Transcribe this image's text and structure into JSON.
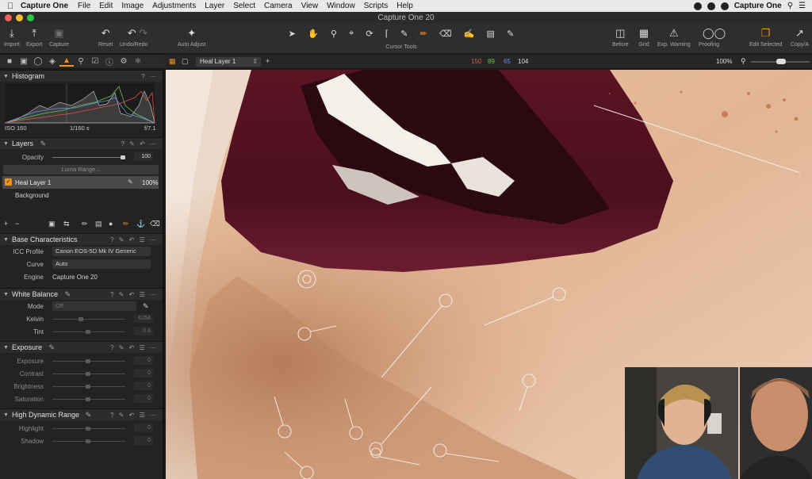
{
  "menubar": {
    "app_name": "Capture One",
    "items": [
      "File",
      "Edit",
      "Image",
      "Adjustments",
      "Layer",
      "Select",
      "Camera",
      "View",
      "Window",
      "Scripts",
      "Help"
    ],
    "right_label": "Capture One"
  },
  "window": {
    "title": "Capture One 20"
  },
  "toolbar": {
    "import": "Import",
    "export": "Export",
    "capture": "Capture",
    "reset": "Reset",
    "undo_redo": "Undo/Redo",
    "auto_adjust": "Auto Adjust",
    "cursor_tools": "Cursor Tools",
    "before": "Before",
    "grid": "Grid",
    "exp_warning": "Exp. Warning",
    "proofing": "Proofing",
    "edit_selected": "Edit Selected",
    "copy_apply": "Copy/A"
  },
  "viewer_bar": {
    "layer": "Heal Layer 1",
    "r": "150",
    "g": "89",
    "b": "65",
    "l": "104",
    "zoom": "100%"
  },
  "histogram": {
    "title": "Histogram",
    "iso": "ISO 160",
    "shutter": "1/160 s",
    "aperture": "f/7.1"
  },
  "layers": {
    "title": "Layers",
    "opacity_label": "Opacity",
    "opacity_value": "100",
    "opacity_level": 1.0,
    "luma_range": "Luma Range...",
    "items": [
      {
        "name": "Heal Layer 1",
        "value": "100%"
      },
      {
        "name": "Background"
      }
    ]
  },
  "base_characteristics": {
    "title": "Base Characteristics",
    "icc_label": "ICC Profile",
    "icc_value": "Canon EOS-5D Mk IV Generic",
    "curve_label": "Curve",
    "curve_value": "Auto",
    "engine_label": "Engine",
    "engine_value": "Capture One 20"
  },
  "white_balance": {
    "title": "White Balance",
    "mode_label": "Mode",
    "mode_value": "Off",
    "kelvin_label": "Kelvin",
    "kelvin_value": "6254",
    "tint_label": "Tint",
    "tint_value": "0.4"
  },
  "exposure": {
    "title": "Exposure",
    "rows": [
      {
        "label": "Exposure",
        "value": "0"
      },
      {
        "label": "Contrast",
        "value": "0"
      },
      {
        "label": "Brightness",
        "value": "0"
      },
      {
        "label": "Saturation",
        "value": "0"
      }
    ]
  },
  "hdr": {
    "title": "High Dynamic Range",
    "rows": [
      {
        "label": "Highlight",
        "value": "0"
      },
      {
        "label": "Shadow",
        "value": "0"
      }
    ]
  },
  "colors": {
    "accent": "#f0921e",
    "red_readout": "#e0524c",
    "green_readout": "#6ec64a",
    "blue_readout": "#6c8ee8"
  }
}
